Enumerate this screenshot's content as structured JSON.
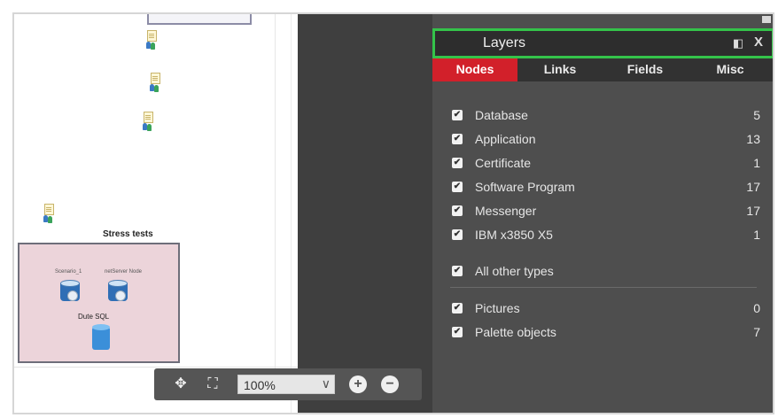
{
  "canvas": {
    "group_title": "Stress tests",
    "server1_label": "Scenario_1",
    "server2_label": "netServer Node",
    "db_label": "Dute SQL"
  },
  "toolbar": {
    "zoom_value": "100%",
    "move_icon": "move-arrows-icon",
    "fit_icon": "fit-screen-icon",
    "zoom_in_icon": "plus-circle-icon",
    "zoom_out_icon": "minus-circle-icon"
  },
  "panel": {
    "title": "Layers",
    "tabs": [
      {
        "label": "Nodes",
        "active": true
      },
      {
        "label": "Links",
        "active": false
      },
      {
        "label": "Fields",
        "active": false
      },
      {
        "label": "Misc",
        "active": false
      }
    ],
    "node_types": [
      {
        "label": "Database",
        "count": "5",
        "checked": true
      },
      {
        "label": "Application",
        "count": "13",
        "checked": true
      },
      {
        "label": "Certificate",
        "count": "1",
        "checked": true
      },
      {
        "label": "Software Program",
        "count": "17",
        "checked": true
      },
      {
        "label": "Messenger",
        "count": "17",
        "checked": true
      },
      {
        "label": "IBM x3850 X5",
        "count": "1",
        "checked": true
      }
    ],
    "other_types": {
      "label": "All other types",
      "checked": true
    },
    "extras": [
      {
        "label": "Pictures",
        "count": "0",
        "checked": true
      },
      {
        "label": "Palette objects",
        "count": "7",
        "checked": true
      }
    ]
  },
  "colors": {
    "active_tab": "#d2202a",
    "header_outline": "#34c34a",
    "panel_bg": "#4e4e4e"
  }
}
